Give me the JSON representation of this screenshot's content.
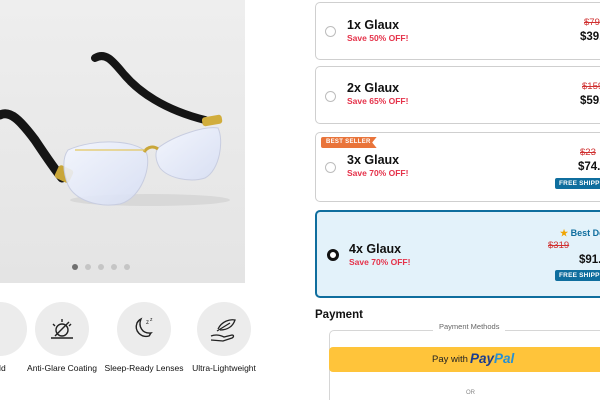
{
  "gallery": {
    "image_alt": "rimless reading glasses with black temples",
    "slide_count": 5,
    "active_slide": 1
  },
  "features": [
    {
      "label": "eld",
      "icon": "shield-icon"
    },
    {
      "label": "Anti-Glare Coating",
      "icon": "anti-glare-icon"
    },
    {
      "label": "Sleep-Ready Lenses",
      "icon": "moon-icon"
    },
    {
      "label": "Ultra-Lightweight",
      "icon": "feather-hand-icon"
    }
  ],
  "options": [
    {
      "qty": "1x Glaux",
      "save": "Save 50% OFF!",
      "old": "$79",
      "price": "$39."
    },
    {
      "qty": "2x Glaux",
      "save": "Save 65% OFF!",
      "old": "$159",
      "price": "$59."
    },
    {
      "qty": "3x Glaux",
      "save": "Save 70% OFF!",
      "old": "$23",
      "price": "$74.",
      "badge": "BEST SELLER",
      "shipping": "FREE SHIPPI"
    },
    {
      "qty": "4x Glaux",
      "save": "Save 70% OFF!",
      "old": "$319",
      "price": "$91.",
      "tag": "Best De",
      "shipping": "FREE SHIPPIN"
    }
  ],
  "selected_option": 4,
  "payment": {
    "title": "Payment",
    "methods_label": "Payment Methods",
    "paypal_prefix": "Pay with",
    "paypal_pay": "Pay",
    "paypal_pal": "Pal",
    "or": "OR"
  },
  "colors": {
    "accent_blue": "#0f6e9e",
    "discount_red": "#e5324a",
    "badge_orange": "#e9743a",
    "paypal_yellow": "#ffc43a"
  }
}
